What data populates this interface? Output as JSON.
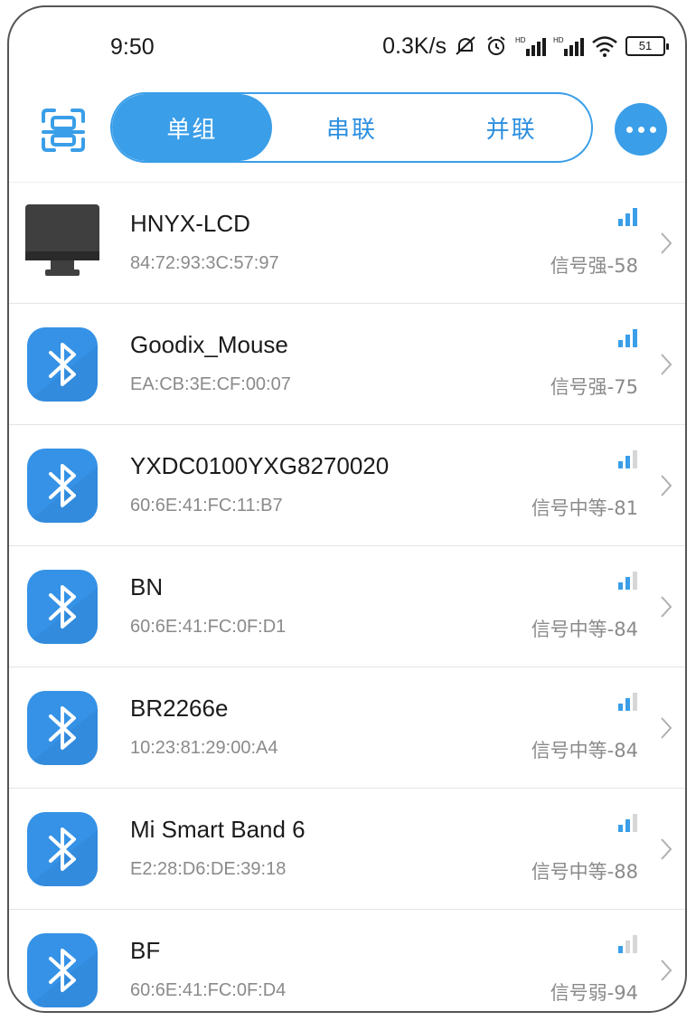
{
  "status_bar": {
    "time": "9:50",
    "net_speed": "0.3K/s",
    "battery": "51"
  },
  "tabs": [
    {
      "label": "单组",
      "active": true
    },
    {
      "label": "串联",
      "active": false
    },
    {
      "label": "并联",
      "active": false
    }
  ],
  "accent_color": "#3a9ee8",
  "devices": [
    {
      "name": "HNYX-LCD",
      "mac": "84:72:93:3C:57:97",
      "signal": "信号强-58",
      "bars": 3,
      "icon": "monitor-icon"
    },
    {
      "name": "Goodix_Mouse",
      "mac": "EA:CB:3E:CF:00:07",
      "signal": "信号强-75",
      "bars": 3,
      "icon": "bluetooth-icon"
    },
    {
      "name": "YXDC0100YXG8270020",
      "mac": "60:6E:41:FC:11:B7",
      "signal": "信号中等-81",
      "bars": 2,
      "icon": "bluetooth-icon"
    },
    {
      "name": "BN",
      "mac": "60:6E:41:FC:0F:D1",
      "signal": "信号中等-84",
      "bars": 2,
      "icon": "bluetooth-icon"
    },
    {
      "name": "BR2266e",
      "mac": "10:23:81:29:00:A4",
      "signal": "信号中等-84",
      "bars": 2,
      "icon": "bluetooth-icon"
    },
    {
      "name": "Mi Smart Band 6",
      "mac": "E2:28:D6:DE:39:18",
      "signal": "信号中等-88",
      "bars": 2,
      "icon": "bluetooth-icon"
    },
    {
      "name": "BF",
      "mac": "60:6E:41:FC:0F:D4",
      "signal": "信号弱-94",
      "bars": 1,
      "icon": "bluetooth-icon"
    }
  ]
}
